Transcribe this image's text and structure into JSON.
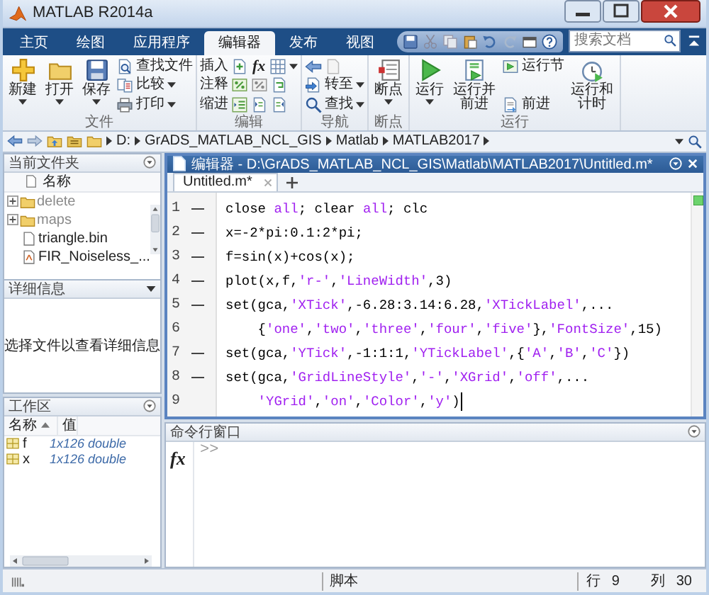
{
  "window": {
    "title": "MATLAB R2014a"
  },
  "tabs": [
    {
      "label": "主页",
      "selected": false
    },
    {
      "label": "绘图",
      "selected": false
    },
    {
      "label": "应用程序",
      "selected": false
    },
    {
      "label": "编辑器",
      "selected": true
    },
    {
      "label": "发布",
      "selected": false
    },
    {
      "label": "视图",
      "selected": false
    }
  ],
  "search": {
    "placeholder": "搜索文档"
  },
  "ribbon": {
    "groups": [
      {
        "title": "文件",
        "items": [
          {
            "kind": "large",
            "label": "新建",
            "dropdown": true
          },
          {
            "kind": "large",
            "label": "打开",
            "dropdown": true
          },
          {
            "kind": "large",
            "label": "保存",
            "dropdown": true
          },
          {
            "kind": "stack",
            "rows": [
              {
                "kind": "button",
                "label": "查找文件",
                "dropdown": false
              },
              {
                "kind": "button",
                "label": "比较",
                "dropdown": true
              },
              {
                "kind": "button",
                "label": "打印",
                "dropdown": true
              }
            ]
          }
        ]
      },
      {
        "title": "编辑",
        "items": [
          {
            "kind": "stack",
            "rows": [
              {
                "kind": "labeled_tools",
                "label": "插入",
                "tools": [
                  {
                    "kind": "icon"
                  },
                  {
                    "kind": "glyph",
                    "text": "fx"
                  },
                  {
                    "kind": "icon"
                  },
                  {
                    "kind": "caret"
                  }
                ]
              },
              {
                "kind": "labeled_tools",
                "label": "注释",
                "tools": [
                  {
                    "kind": "icon"
                  },
                  {
                    "kind": "icon"
                  },
                  {
                    "kind": "icon"
                  }
                ]
              },
              {
                "kind": "labeled_tools",
                "label": "缩进",
                "tools": [
                  {
                    "kind": "icon"
                  },
                  {
                    "kind": "icon"
                  },
                  {
                    "kind": "icon"
                  }
                ]
              }
            ]
          }
        ]
      },
      {
        "title": "导航",
        "items": [
          {
            "kind": "stack",
            "rows": [
              {
                "kind": "tools",
                "tools": [
                  {
                    "kind": "icon"
                  },
                  {
                    "kind": "icon"
                  }
                ]
              },
              {
                "kind": "button",
                "label": "转至",
                "dropdown": true
              },
              {
                "kind": "button",
                "label": "查找",
                "dropdown": true
              }
            ]
          }
        ]
      },
      {
        "title": "断点",
        "items": [
          {
            "kind": "large",
            "label": "断点",
            "dropdown": true
          }
        ]
      },
      {
        "title": "运行",
        "items": [
          {
            "kind": "large",
            "label": "运行",
            "dropdown": true
          },
          {
            "kind": "large",
            "label": "运行并前进",
            "dropdown": false
          },
          {
            "kind": "stack",
            "rows": [
              {
                "kind": "button",
                "label": "运行节",
                "dropdown": false
              },
              {
                "kind": "button",
                "label": "前进",
                "dropdown": false
              }
            ]
          },
          {
            "kind": "large",
            "label": "运行和计时",
            "dropdown": false
          }
        ]
      }
    ]
  },
  "address": {
    "path": [
      "D:",
      "GrADS_MATLAB_NCL_GIS",
      "Matlab",
      "MATLAB2017"
    ]
  },
  "current_folder": {
    "title": "当前文件夹",
    "column": "名称",
    "items": [
      {
        "name": "delete",
        "kind": "folder",
        "expandable": true
      },
      {
        "name": "maps",
        "kind": "folder",
        "expandable": true
      },
      {
        "name": "triangle.bin",
        "kind": "file",
        "expandable": false
      },
      {
        "name": "FIR_Noiseless_...",
        "kind": "mfile",
        "expandable": false
      }
    ]
  },
  "details": {
    "title": "详细信息",
    "message": "选择文件以查看详细信息"
  },
  "workspace": {
    "title": "工作区",
    "columns": [
      {
        "label": "名称",
        "sorted": true
      },
      {
        "label": "值",
        "sorted": false
      }
    ],
    "variables": [
      {
        "name": "f",
        "value": "1x126 double"
      },
      {
        "name": "x",
        "value": "1x126 double"
      }
    ]
  },
  "editor": {
    "title": "编辑器 - D:\\GrADS_MATLAB_NCL_GIS\\Matlab\\MATLAB2017\\Untitled.m*",
    "tabs": [
      {
        "label": "Untitled.m*",
        "selected": true
      }
    ],
    "lines": [
      {
        "number": "1",
        "executable": true,
        "continuation": false,
        "has_cursor": false,
        "tokens": [
          {
            "kind": "plain",
            "text": "close "
          },
          {
            "kind": "string",
            "text": "all"
          },
          {
            "kind": "plain",
            "text": "; clear "
          },
          {
            "kind": "string",
            "text": "all"
          },
          {
            "kind": "plain",
            "text": "; clc"
          }
        ]
      },
      {
        "number": "2",
        "executable": true,
        "continuation": false,
        "has_cursor": false,
        "tokens": [
          {
            "kind": "plain",
            "text": "x=-2*pi:0.1:2*pi;"
          }
        ]
      },
      {
        "number": "3",
        "executable": true,
        "continuation": false,
        "has_cursor": false,
        "tokens": [
          {
            "kind": "plain",
            "text": "f=sin(x)+cos(x);"
          }
        ]
      },
      {
        "number": "4",
        "executable": true,
        "continuation": false,
        "has_cursor": false,
        "tokens": [
          {
            "kind": "plain",
            "text": "plot(x,f,"
          },
          {
            "kind": "string",
            "text": "'r-'"
          },
          {
            "kind": "plain",
            "text": ","
          },
          {
            "kind": "string",
            "text": "'LineWidth'"
          },
          {
            "kind": "plain",
            "text": ",3)"
          }
        ]
      },
      {
        "number": "5",
        "executable": true,
        "continuation": false,
        "has_cursor": false,
        "tokens": [
          {
            "kind": "plain",
            "text": "set(gca,"
          },
          {
            "kind": "string",
            "text": "'XTick'"
          },
          {
            "kind": "plain",
            "text": ",-6.28:3.14:6.28,"
          },
          {
            "kind": "string",
            "text": "'XTickLabel'"
          },
          {
            "kind": "plain",
            "text": ",..."
          }
        ]
      },
      {
        "number": "6",
        "executable": false,
        "continuation": true,
        "has_cursor": false,
        "tokens": [
          {
            "kind": "plain",
            "text": "{"
          },
          {
            "kind": "string",
            "text": "'one'"
          },
          {
            "kind": "plain",
            "text": ","
          },
          {
            "kind": "string",
            "text": "'two'"
          },
          {
            "kind": "plain",
            "text": ","
          },
          {
            "kind": "string",
            "text": "'three'"
          },
          {
            "kind": "plain",
            "text": ","
          },
          {
            "kind": "string",
            "text": "'four'"
          },
          {
            "kind": "plain",
            "text": ","
          },
          {
            "kind": "string",
            "text": "'five'"
          },
          {
            "kind": "plain",
            "text": "},"
          },
          {
            "kind": "string",
            "text": "'FontSize'"
          },
          {
            "kind": "plain",
            "text": ",15)"
          }
        ]
      },
      {
        "number": "7",
        "executable": true,
        "continuation": false,
        "has_cursor": false,
        "tokens": [
          {
            "kind": "plain",
            "text": "set(gca,"
          },
          {
            "kind": "string",
            "text": "'YTick'"
          },
          {
            "kind": "plain",
            "text": ",-1:1:1,"
          },
          {
            "kind": "string",
            "text": "'YTickLabel'"
          },
          {
            "kind": "plain",
            "text": ",{"
          },
          {
            "kind": "string",
            "text": "'A'"
          },
          {
            "kind": "plain",
            "text": ","
          },
          {
            "kind": "string",
            "text": "'B'"
          },
          {
            "kind": "plain",
            "text": ","
          },
          {
            "kind": "string",
            "text": "'C'"
          },
          {
            "kind": "plain",
            "text": "})"
          }
        ]
      },
      {
        "number": "8",
        "executable": true,
        "continuation": false,
        "has_cursor": false,
        "tokens": [
          {
            "kind": "plain",
            "text": "set(gca,"
          },
          {
            "kind": "string",
            "text": "'GridLineStyle'"
          },
          {
            "kind": "plain",
            "text": ","
          },
          {
            "kind": "string",
            "text": "'-'"
          },
          {
            "kind": "plain",
            "text": ","
          },
          {
            "kind": "string",
            "text": "'XGrid'"
          },
          {
            "kind": "plain",
            "text": ","
          },
          {
            "kind": "string",
            "text": "'off'"
          },
          {
            "kind": "plain",
            "text": ",..."
          }
        ]
      },
      {
        "number": "9",
        "executable": false,
        "continuation": true,
        "has_cursor": true,
        "tokens": [
          {
            "kind": "string",
            "text": "'YGrid'"
          },
          {
            "kind": "plain",
            "text": ","
          },
          {
            "kind": "string",
            "text": "'on'"
          },
          {
            "kind": "plain",
            "text": ","
          },
          {
            "kind": "string",
            "text": "'Color'"
          },
          {
            "kind": "plain",
            "text": ","
          },
          {
            "kind": "string",
            "text": "'y'"
          },
          {
            "kind": "plain",
            "text": ")"
          }
        ]
      }
    ]
  },
  "command_window": {
    "title": "命令行窗口",
    "fx": "fx",
    "prompt": ">>"
  },
  "status_bar": {
    "mode": "脚本",
    "row_label": "行",
    "row": "9",
    "col_label": "列",
    "col": "30"
  }
}
